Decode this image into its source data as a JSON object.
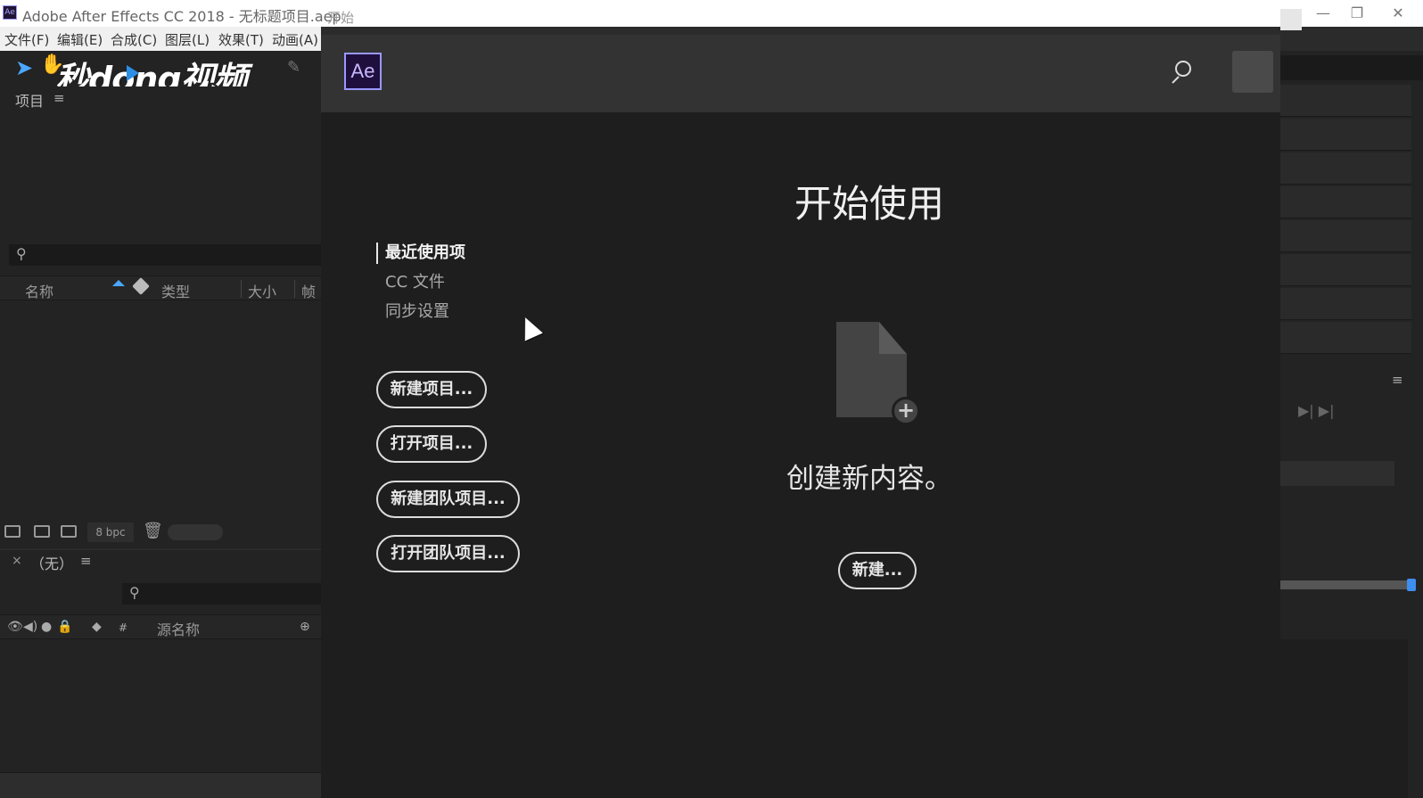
{
  "window": {
    "app_icon": "Ae",
    "title": "Adobe After Effects CC 2018 - 无标题项目.aep",
    "dialog_title": "开始",
    "minimize_icon": "minimize-icon",
    "restore_icon": "restore-icon",
    "close_icon": "close-icon"
  },
  "menu": [
    "文件(F)",
    "编辑(E)",
    "合成(C)",
    "图层(L)",
    "效果(T)",
    "动画(A)"
  ],
  "watermark": {
    "text": "秒dong视频"
  },
  "project_panel": {
    "tab": "项目",
    "columns": [
      "名称",
      "类型",
      "大小",
      "帧"
    ],
    "bpc": "8 bpc"
  },
  "comp_panel": {
    "name": "（无）",
    "columns": [
      "#",
      "源名称"
    ]
  },
  "start_dialog": {
    "logo": "Ae",
    "heading": "开始使用",
    "nav": [
      {
        "label": "最近使用项",
        "active": true
      },
      {
        "label": "CC 文件",
        "active": false
      },
      {
        "label": "同步设置",
        "active": false
      }
    ],
    "buttons": {
      "new_project": "新建项目...",
      "open_project": "打开项目...",
      "new_team_project": "新建团队项目...",
      "open_team_project": "打开团队项目...",
      "new": "新建..."
    },
    "create_label": "创建新内容。"
  }
}
